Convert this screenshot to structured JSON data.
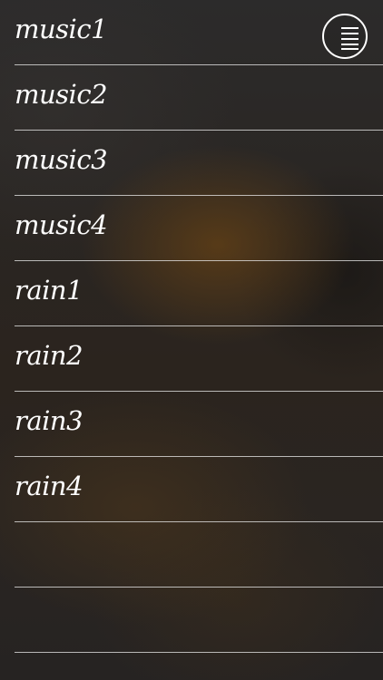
{
  "sound_list": {
    "items": [
      {
        "label": "music1"
      },
      {
        "label": "music2"
      },
      {
        "label": "music3"
      },
      {
        "label": "music4"
      },
      {
        "label": "rain1"
      },
      {
        "label": "rain2"
      },
      {
        "label": "rain3"
      },
      {
        "label": "rain4"
      },
      {
        "label": ""
      },
      {
        "label": ""
      }
    ]
  },
  "menu_button": {
    "icon": "hamburger-menu-icon"
  },
  "colors": {
    "text": "#ffffff",
    "divider": "#ebebeb",
    "background": "#2a2623",
    "glow": "#5f3e16"
  }
}
